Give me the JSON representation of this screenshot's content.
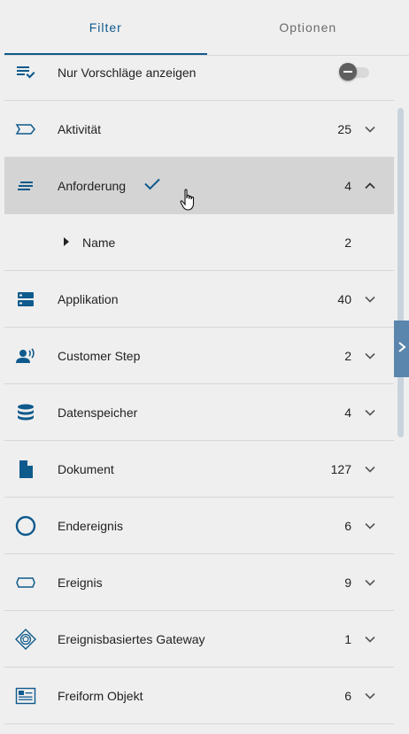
{
  "tabs": [
    {
      "label": "Filter",
      "active": true
    },
    {
      "label": "Optionen",
      "active": false
    }
  ],
  "toggle_row": {
    "label": "Nur Vorschläge anzeigen",
    "icon": "filter-list-check-icon",
    "enabled": false
  },
  "rows": [
    {
      "label": "Aktivität",
      "count": "25",
      "icon": "activity-shape-icon",
      "expanded": false
    },
    {
      "label": "Anforderung",
      "count": "4",
      "icon": "lines-icon",
      "expanded": true,
      "selected": true
    },
    {
      "label": "Name",
      "count": "2",
      "icon": "caret-right-icon",
      "sub": true
    },
    {
      "label": "Applikation",
      "count": "40",
      "icon": "application-server-icon",
      "expanded": false
    },
    {
      "label": "Customer Step",
      "count": "2",
      "icon": "speaking-person-icon",
      "expanded": false
    },
    {
      "label": "Datenspeicher",
      "count": "4",
      "icon": "database-icon",
      "expanded": false
    },
    {
      "label": "Dokument",
      "count": "127",
      "icon": "document-icon",
      "expanded": false
    },
    {
      "label": "Endereignis",
      "count": "6",
      "icon": "end-event-circle-icon",
      "expanded": false
    },
    {
      "label": "Ereignis",
      "count": "9",
      "icon": "event-shape-icon",
      "expanded": false
    },
    {
      "label": "Ereignisbasiertes Gateway",
      "count": "1",
      "icon": "event-gateway-icon",
      "expanded": false
    },
    {
      "label": "Freiform Objekt",
      "count": "6",
      "icon": "freeform-object-icon",
      "expanded": false
    }
  ],
  "colors": {
    "accent": "#0f5a8c",
    "selected_row": "#d4d4d4",
    "side_handle": "#5a85ad"
  }
}
